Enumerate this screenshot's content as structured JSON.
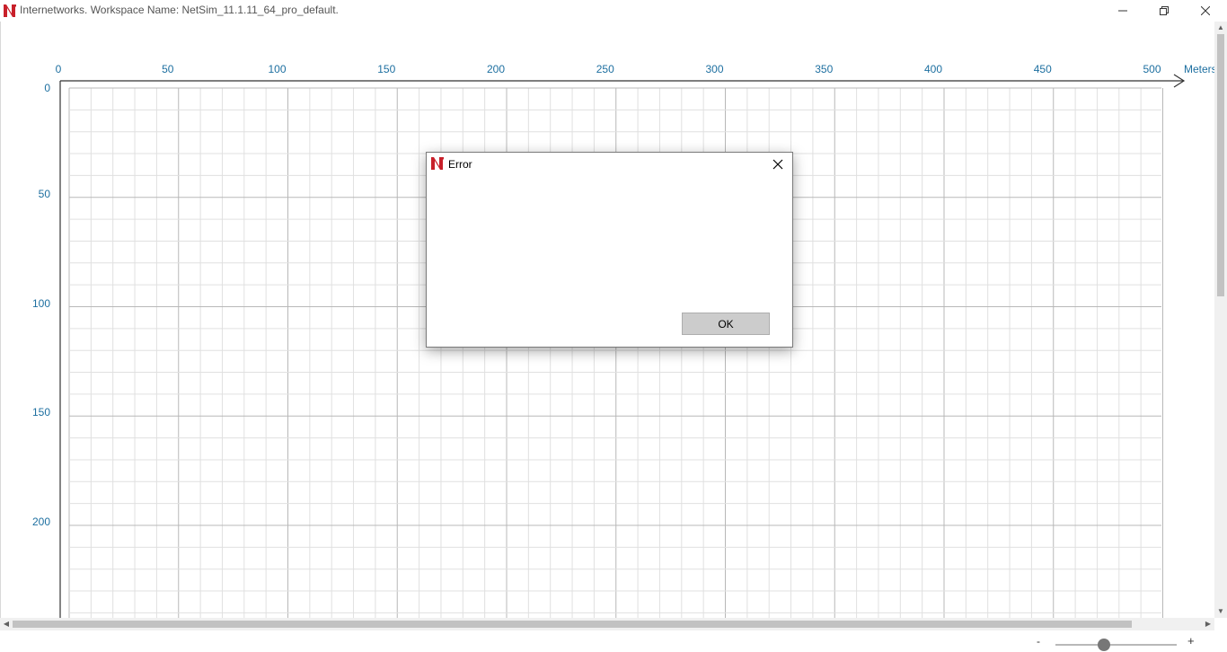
{
  "window": {
    "title": "Internetworks. Workspace Name: NetSim_11.1.11_64_pro_default.",
    "icon": "netsim-logo-icon"
  },
  "workspace": {
    "x_ticks": [
      "0",
      "50",
      "100",
      "150",
      "200",
      "250",
      "300",
      "350",
      "400",
      "450",
      "500"
    ],
    "y_ticks": [
      "0",
      "50",
      "100",
      "150",
      "200"
    ],
    "x_unit": "Meters"
  },
  "dialog": {
    "title": "Error",
    "message": "",
    "ok_label": "OK"
  },
  "zoom": {
    "minus_label": "-",
    "plus_label": "+",
    "level": 0.4
  }
}
